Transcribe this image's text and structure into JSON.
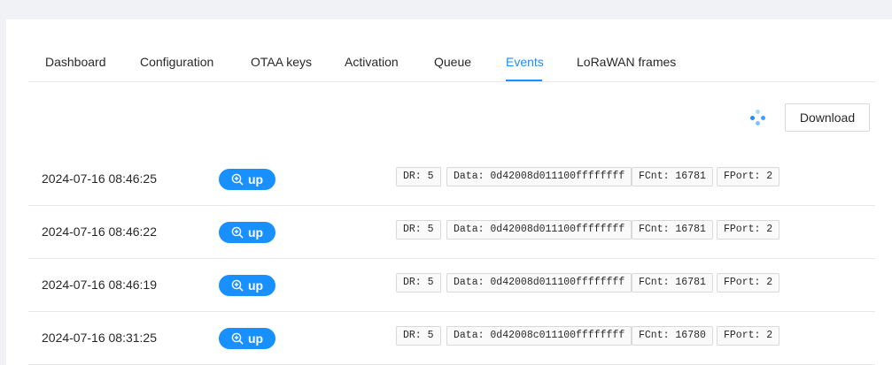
{
  "tabs": [
    {
      "label": "Dashboard"
    },
    {
      "label": "Configuration"
    },
    {
      "label": "OTAA keys"
    },
    {
      "label": "Activation"
    },
    {
      "label": "Queue"
    },
    {
      "label": "Events"
    },
    {
      "label": "LoRaWAN frames"
    }
  ],
  "active_tab": "Events",
  "toolbar": {
    "download_label": "Download"
  },
  "events": [
    {
      "timestamp": "2024-07-16 08:46:25",
      "type": "up",
      "dr": "DR: 5",
      "data": "Data: 0d42008d011100ffffffff",
      "fcnt": "FCnt: 16781",
      "fport": "FPort: 2"
    },
    {
      "timestamp": "2024-07-16 08:46:22",
      "type": "up",
      "dr": "DR: 5",
      "data": "Data: 0d42008d011100ffffffff",
      "fcnt": "FCnt: 16781",
      "fport": "FPort: 2"
    },
    {
      "timestamp": "2024-07-16 08:46:19",
      "type": "up",
      "dr": "DR: 5",
      "data": "Data: 0d42008d011100ffffffff",
      "fcnt": "FCnt: 16781",
      "fport": "FPort: 2"
    },
    {
      "timestamp": "2024-07-16 08:31:25",
      "type": "up",
      "dr": "DR: 5",
      "data": "Data: 0d42008c011100ffffffff",
      "fcnt": "FCnt: 16780",
      "fport": "FPort: 2"
    }
  ],
  "colors": {
    "accent": "#1890ff",
    "page_background": "#f0f2f5",
    "card_background": "#ffffff",
    "tag_background": "#fafafa",
    "divider": "#e8e8e8"
  },
  "icons": {
    "event_type": "zoom-in-icon",
    "loading": "loading-spinner-icon"
  }
}
